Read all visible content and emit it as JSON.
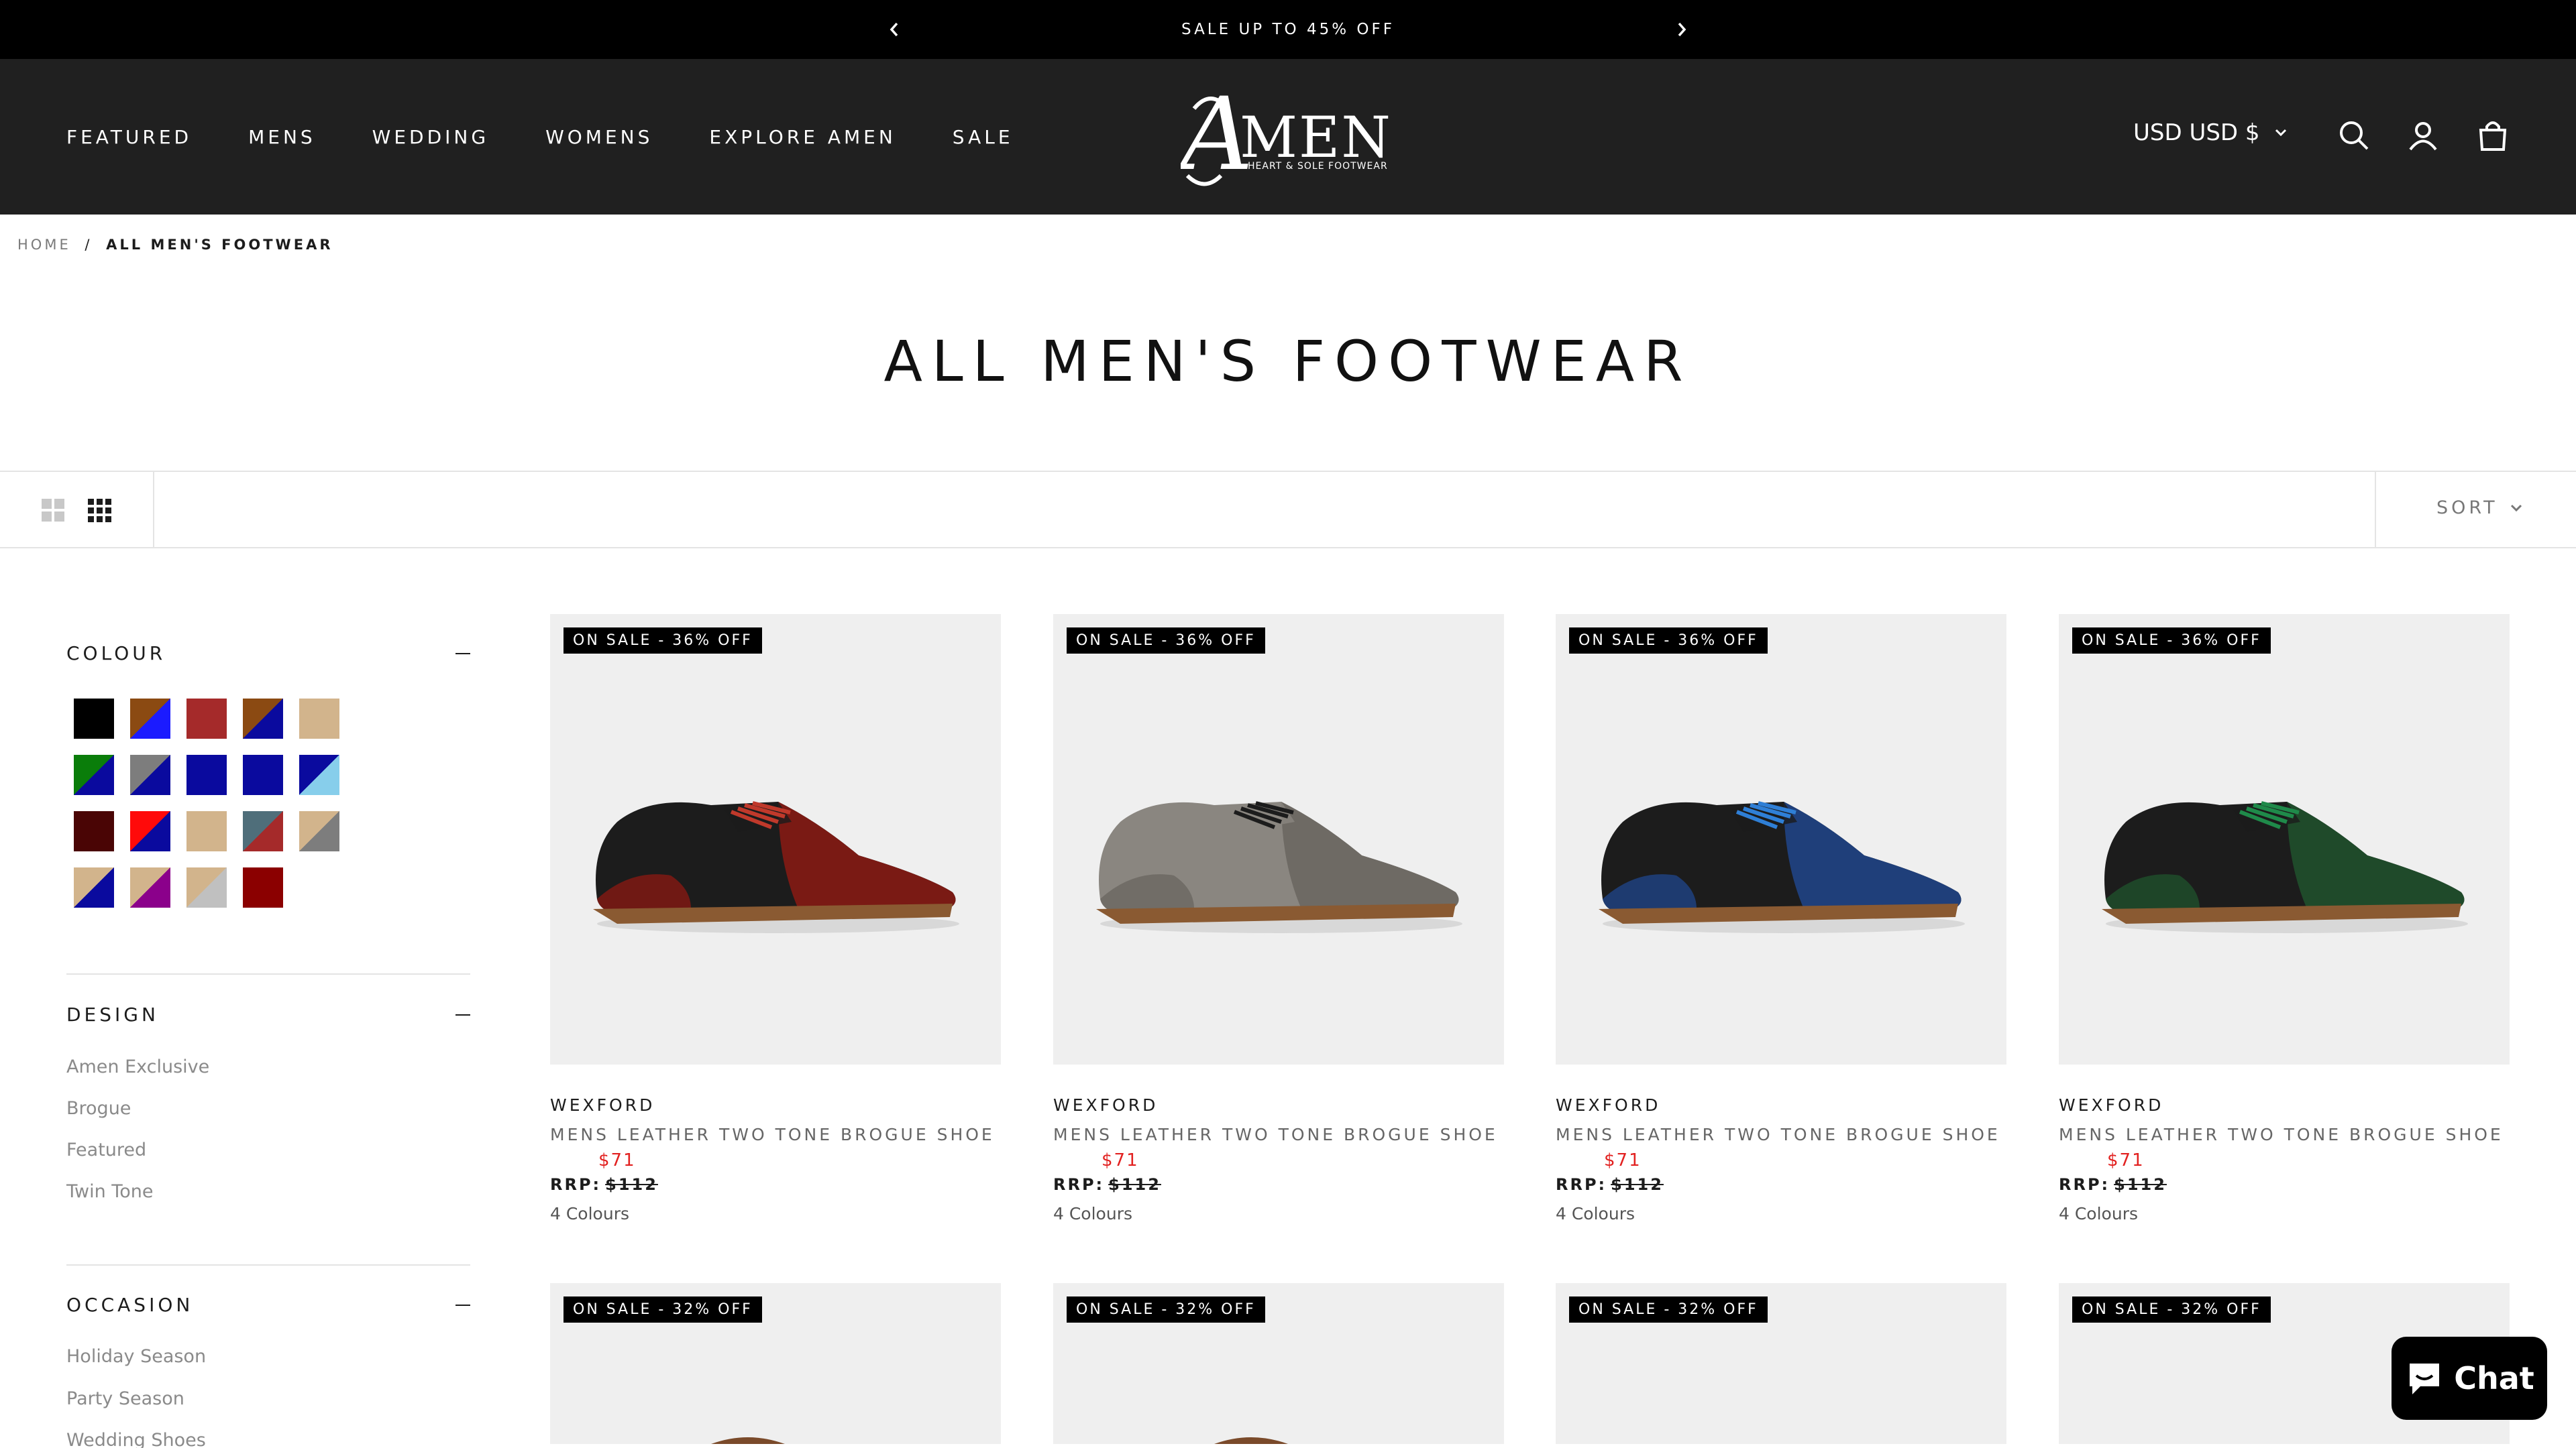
{
  "announcement": {
    "text": "SALE UP TO 45% OFF"
  },
  "nav": {
    "items": [
      "FEATURED",
      "MENS",
      "WEDDING",
      "WOMENS",
      "EXPLORE AMEN",
      "SALE"
    ]
  },
  "logo": {
    "name": "AMEN",
    "tagline": "HEART & SOLE FOOTWEAR"
  },
  "currency": {
    "label": "USD USD $"
  },
  "breadcrumb": {
    "home": "HOME",
    "sep": "/",
    "current": "ALL MEN'S FOOTWEAR"
  },
  "page": {
    "title": "ALL MEN'S FOOTWEAR"
  },
  "toolbar": {
    "sort_label": "SORT"
  },
  "filters": {
    "colour": {
      "title": "COLOUR",
      "swatches": [
        [
          "#000000"
        ],
        [
          "#8b4a12",
          "#1b1bff"
        ],
        [
          "#a52a2a"
        ],
        [
          "#8b4a12",
          "#0a0a9e"
        ],
        [
          "#d2b48c"
        ],
        [
          "#0a7d0a",
          "#0a0a9e"
        ],
        [
          "#7d7d7d",
          "#0a0a9e"
        ],
        [
          "#0a0a9e"
        ],
        [
          "#0a0a9e"
        ],
        [
          "#0a0a9e",
          "#87ceeb"
        ],
        [
          "#4a0505"
        ],
        [
          "#ff0a0a",
          "#0a0a9e"
        ],
        [
          "#d2b48c"
        ],
        [
          "#4f6e7a",
          "#a52a2a"
        ],
        [
          "#d2b48c",
          "#7d7d7d"
        ],
        [
          "#d2b48c",
          "#0a0a9e"
        ],
        [
          "#d2b48c",
          "#8b008b"
        ],
        [
          "#d2b48c",
          "#c0c0c0"
        ],
        [
          "#8b0000"
        ]
      ]
    },
    "design": {
      "title": "DESIGN",
      "items": [
        "Amen Exclusive",
        "Brogue",
        "Featured",
        "Twin Tone"
      ]
    },
    "occasion": {
      "title": "OCCASION",
      "items": [
        "Holiday Season",
        "Party Season",
        "Wedding Shoes"
      ]
    }
  },
  "products": [
    {
      "badge": "ON SALE - 36% OFF",
      "vendor": "WEXFORD",
      "name": "MENS LEATHER TWO TONE BROGUE SHOE",
      "sale_price": "$71",
      "rrp_label": "RRP:",
      "rrp": "$112",
      "colours": "4 Colours",
      "accent": "#7a1a14",
      "lace": "#c0392b",
      "upper": "#1c1c1c"
    },
    {
      "badge": "ON SALE - 36% OFF",
      "vendor": "WEXFORD",
      "name": "MENS LEATHER TWO TONE BROGUE SHOE",
      "sale_price": "$71",
      "rrp_label": "RRP:",
      "rrp": "$112",
      "colours": "4 Colours",
      "accent": "#6e6a64",
      "lace": "#1c1c1c",
      "upper": "#8a8680"
    },
    {
      "badge": "ON SALE - 36% OFF",
      "vendor": "WEXFORD",
      "name": "MENS LEATHER TWO TONE BROGUE SHOE",
      "sale_price": "$71",
      "rrp_label": "RRP:",
      "rrp": "$112",
      "colours": "4 Colours",
      "accent": "#1f3f7a",
      "lace": "#2f7fd6",
      "upper": "#1c1c1c"
    },
    {
      "badge": "ON SALE - 36% OFF",
      "vendor": "WEXFORD",
      "name": "MENS LEATHER TWO TONE BROGUE SHOE",
      "sale_price": "$71",
      "rrp_label": "RRP:",
      "rrp": "$112",
      "colours": "4 Colours",
      "accent": "#1f4a2a",
      "lace": "#1f8a4a",
      "upper": "#1c1c1c"
    }
  ],
  "products_row2": [
    {
      "badge": "ON SALE - 32% OFF"
    },
    {
      "badge": "ON SALE - 32% OFF"
    },
    {
      "badge": "ON SALE - 32% OFF"
    },
    {
      "badge": "ON SALE - 32% OFF"
    }
  ],
  "chat": {
    "label": "Chat"
  }
}
